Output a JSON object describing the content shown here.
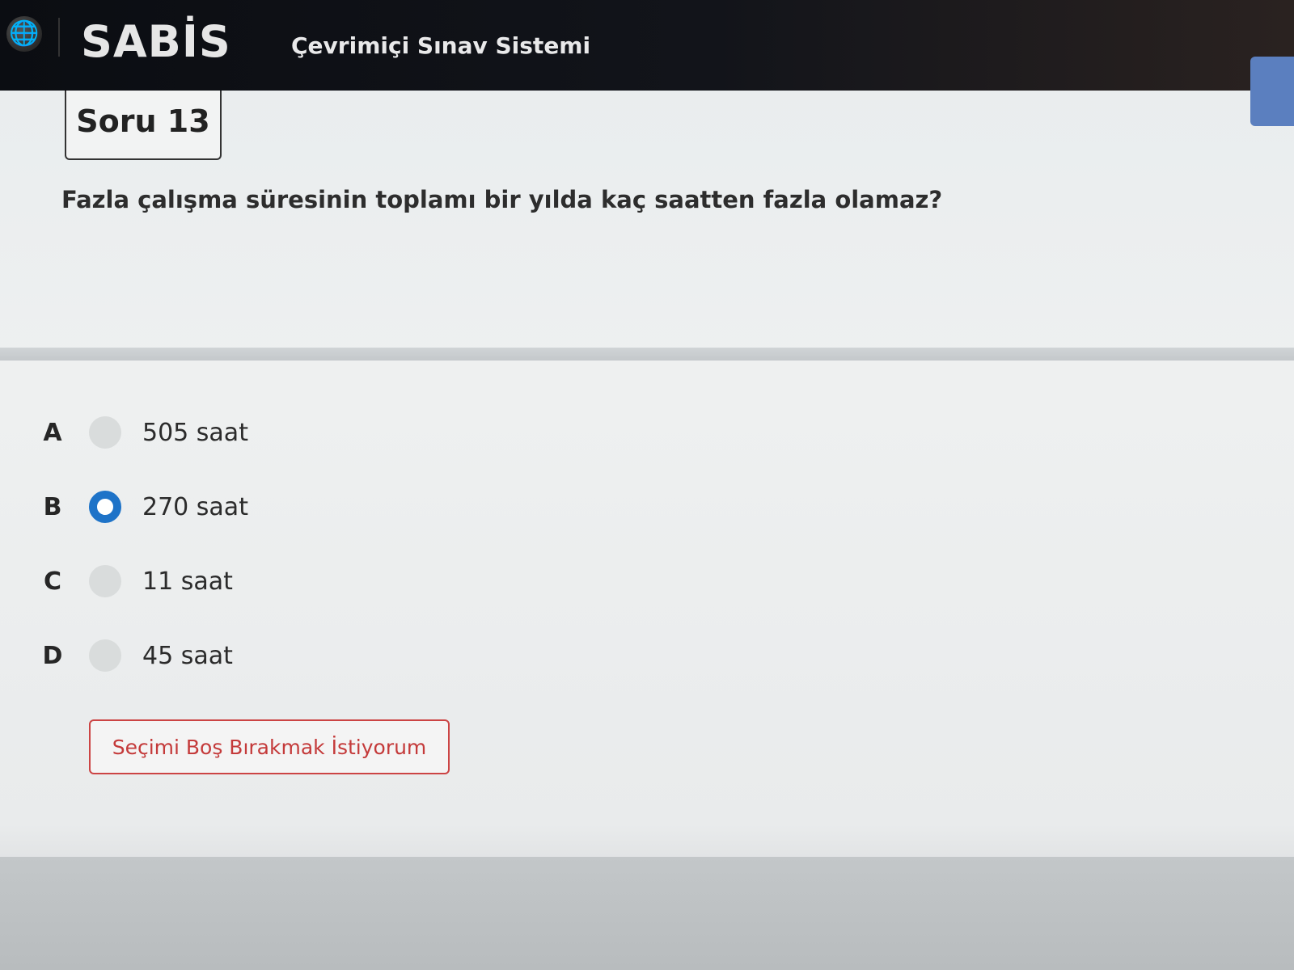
{
  "header": {
    "logo": "SABİS",
    "app_title": "Çevrimiçi Sınav Sistemi"
  },
  "question": {
    "number_label": "Soru 13",
    "text": "Fazla çalışma süresinin toplamı bir yılda kaç saatten fazla olamaz?"
  },
  "options": [
    {
      "letter": "A",
      "text": "505 saat",
      "selected": false
    },
    {
      "letter": "B",
      "text": "270 saat",
      "selected": true
    },
    {
      "letter": "C",
      "text": "11 saat",
      "selected": false
    },
    {
      "letter": "D",
      "text": "45 saat",
      "selected": false
    }
  ],
  "actions": {
    "skip_label": "Seçimi Boş Bırakmak İstiyorum"
  },
  "colors": {
    "accent": "#1e73c8",
    "danger": "#c43a3a",
    "header_bg": "#0b0d12"
  }
}
